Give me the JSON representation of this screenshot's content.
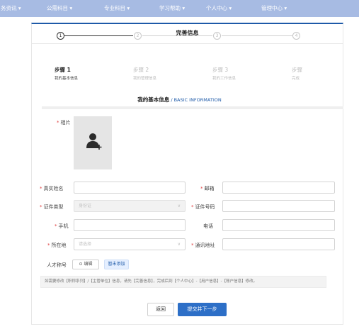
{
  "nav": {
    "items": [
      "务资讯 ▾",
      "公需科目 ▾",
      "专业科目 ▾",
      "学习帮助 ▾",
      "个人中心 ▾",
      "管理中心 ▾"
    ]
  },
  "card": {
    "title": "完善信息"
  },
  "steps": [
    {
      "num": "1",
      "title": "步骤 1",
      "sub": "我的基本信息"
    },
    {
      "num": "2",
      "title": "步骤 2",
      "sub": "我的管理信息"
    },
    {
      "num": "3",
      "title": "步骤 3",
      "sub": "我的工作信息"
    },
    {
      "num": "4",
      "title": "步骤",
      "sub": "完成"
    }
  ],
  "section": {
    "title_zh": "我的基本信息",
    "separator": " / ",
    "title_en": "BASIC INFORMATION"
  },
  "form": {
    "required_mark": "*",
    "photo_label": "相片",
    "real_name_label": "真实姓名",
    "email_label": "邮箱",
    "id_type_label": "证件类型",
    "id_type_value": "身份证",
    "id_number_label": "证件号码",
    "phone_label": "手机",
    "tel_label": "电话",
    "location_label": "所在地",
    "location_placeholder": "请选择",
    "address_label": "通讯地址",
    "talent_label": "人才称号",
    "edit_button": "⊙ 编辑",
    "talent_status": "暂未添加",
    "caret": "∨"
  },
  "notice": "如需要修改【职称系列】/【主管单位】信息，请先【完善信息】，完成后到【个人中心】-【用户信息】-【账户信息】修改。",
  "actions": {
    "back": "返回",
    "next": "提交并下一步"
  }
}
